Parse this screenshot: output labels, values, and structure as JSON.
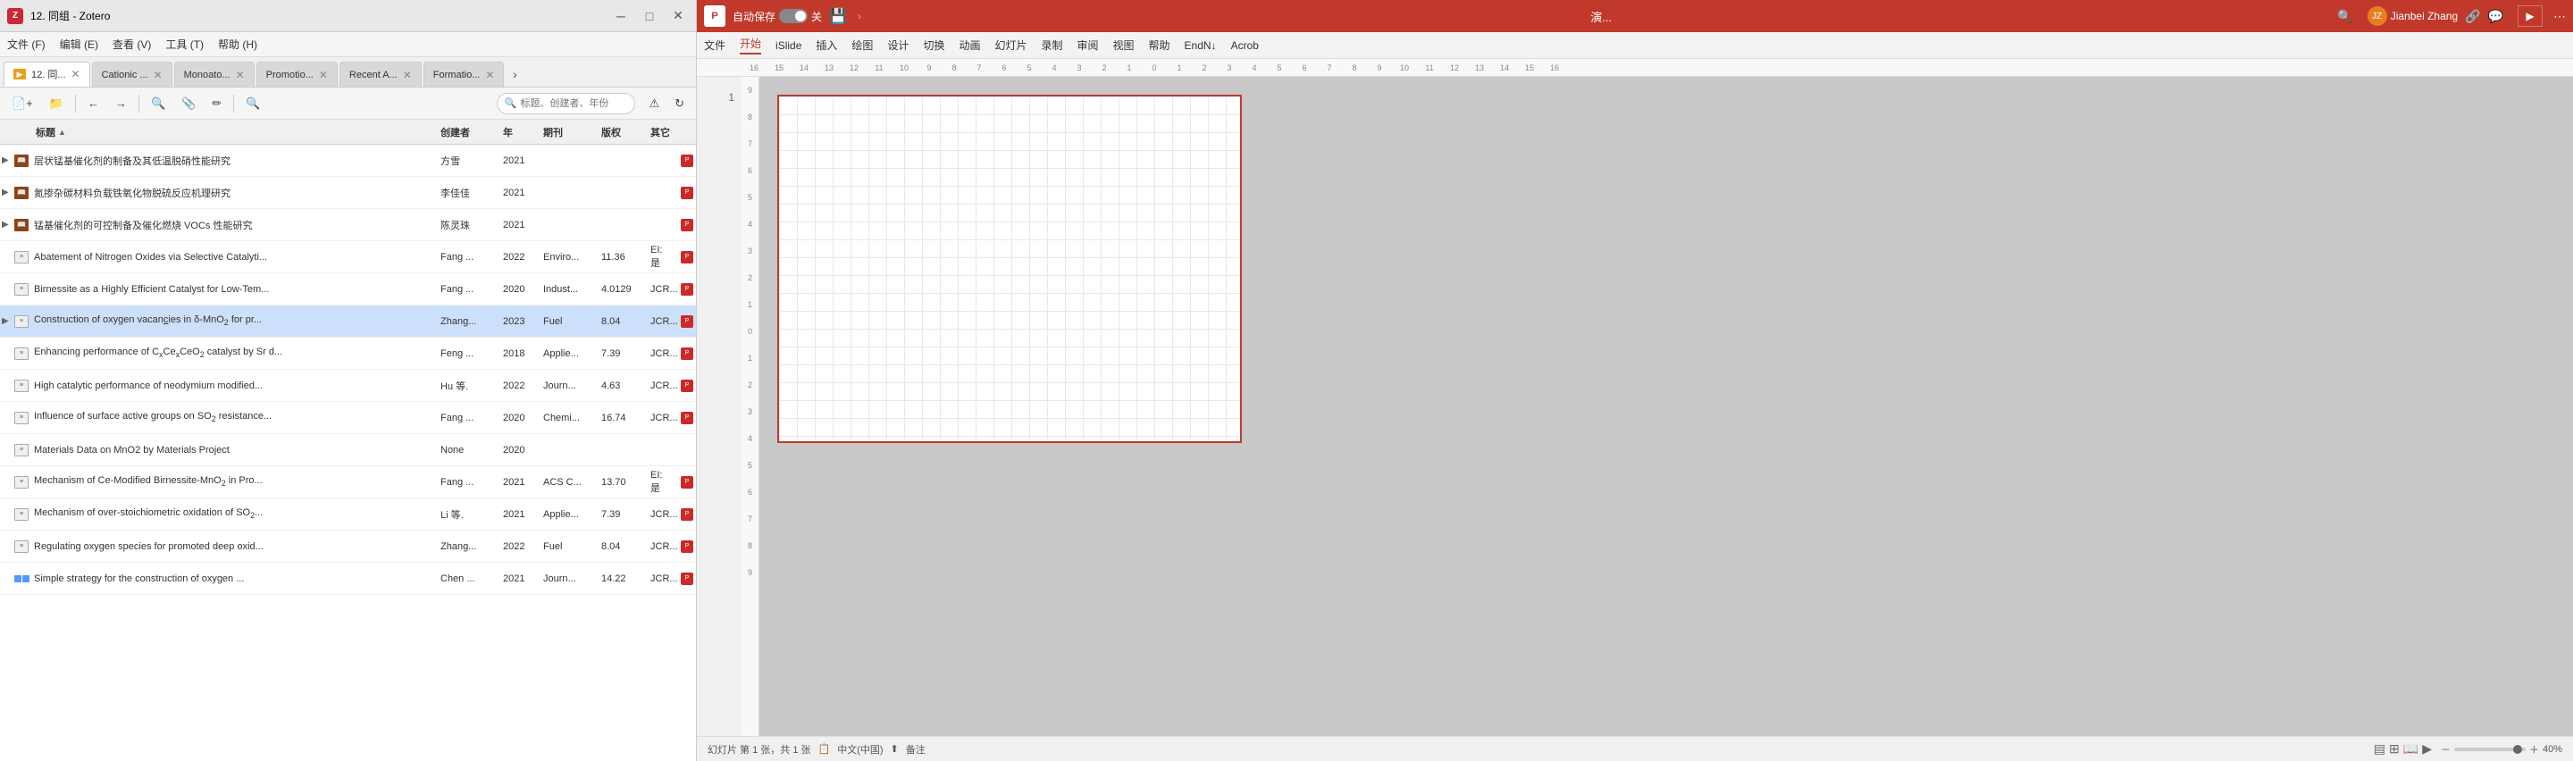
{
  "zotero": {
    "title": "12. 同组 - Zotero",
    "folder_name": "12. 同...",
    "menu": [
      "文件 (F)",
      "编辑 (E)",
      "查看 (V)",
      "工具 (T)",
      "帮助 (H)"
    ],
    "tabs": [
      {
        "label": "12. 同...",
        "active": true,
        "type": "folder"
      },
      {
        "label": "Cationic ...",
        "active": false
      },
      {
        "label": "Monoato...",
        "active": false
      },
      {
        "label": "Promotio...",
        "active": false
      },
      {
        "label": "Recent A...",
        "active": false
      },
      {
        "label": "Formatio...",
        "active": false
      }
    ],
    "search_placeholder": "标题、创建者、年份",
    "columns": {
      "title": "标题",
      "author": "创建者",
      "year": "年",
      "journal": "期刊",
      "rights": "版权",
      "other": "其它"
    },
    "rows": [
      {
        "id": 1,
        "type": "thesis",
        "title": "层状锰基催化剂的制备及其低温脱硝性能研究",
        "author": "方雪",
        "year": "2021",
        "journal": "",
        "rights": "",
        "other": "",
        "has_pdf": true,
        "selected": false
      },
      {
        "id": 2,
        "type": "thesis",
        "title": "氮掺杂碳材料负载铁氧化物脱硫反应机理研究",
        "author": "李佳佳",
        "year": "2021",
        "journal": "",
        "rights": "",
        "other": "",
        "has_pdf": true,
        "selected": false
      },
      {
        "id": 3,
        "type": "thesis",
        "title": "锰基催化剂的可控制备及催化燃烧 VOCs 性能研究",
        "author": "陈灵珠",
        "year": "2021",
        "journal": "",
        "rights": "",
        "other": "",
        "has_pdf": true,
        "selected": false
      },
      {
        "id": 4,
        "type": "article",
        "title": "Abatement of Nitrogen Oxides via Selective Catalyti...",
        "author": "Fang ...",
        "year": "2022",
        "journal": "Enviro...",
        "rights": "11.36",
        "other": "EI: 是",
        "has_pdf": true,
        "selected": false
      },
      {
        "id": 5,
        "type": "article",
        "title": "Birnessite as a Highly Efficient Catalyst for Low-Tem...",
        "author": "Fang ...",
        "year": "2020",
        "journal": "Indust...",
        "rights": "4.0129",
        "other": "JCR...",
        "has_pdf": true,
        "selected": false
      },
      {
        "id": 6,
        "type": "article",
        "title": "Construction of oxygen vacancies in δ-MnO₂ for pr...",
        "author": "Zhang...",
        "year": "2023",
        "journal": "Fuel",
        "rights": "8.04",
        "other": "JCR...",
        "has_pdf": true,
        "selected": true
      },
      {
        "id": 7,
        "type": "article",
        "title": "Enhancing performance of CₓₓCeO₂ catalyst by Sr d...",
        "author": "Feng ...",
        "year": "2018",
        "journal": "Applie...",
        "rights": "7.39",
        "other": "JCR...",
        "has_pdf": true,
        "selected": false
      },
      {
        "id": 8,
        "type": "article",
        "title": "High catalytic performance of neodymium modified...",
        "author": "Hu 等.",
        "year": "2022",
        "journal": "Journ...",
        "rights": "4.63",
        "other": "JCR...",
        "has_pdf": true,
        "selected": false
      },
      {
        "id": 9,
        "type": "article",
        "title": "Influence of surface active groups on SO₂ resistance...",
        "author": "Fang ...",
        "year": "2020",
        "journal": "Chemi...",
        "rights": "16.74",
        "other": "JCR...",
        "has_pdf": true,
        "selected": false
      },
      {
        "id": 10,
        "type": "article_plain",
        "title": "Materials Data on MnO2 by Materials Project",
        "author": "None",
        "year": "2020",
        "journal": "",
        "rights": "",
        "other": "",
        "has_pdf": false,
        "selected": false
      },
      {
        "id": 11,
        "type": "article",
        "title": "Mechanism of Ce-Modified Birnessite-MnO₂ in Pro...",
        "author": "Fang ...",
        "year": "2021",
        "journal": "ACS C...",
        "rights": "13.70",
        "other": "EI: 是",
        "has_pdf": true,
        "selected": false
      },
      {
        "id": 12,
        "type": "article",
        "title": "Mechanism of over-stoichiometric oxidation of SO₂...",
        "author": "Li 等.",
        "year": "2021",
        "journal": "Applie...",
        "rights": "7.39",
        "other": "JCR...",
        "has_pdf": true,
        "selected": false
      },
      {
        "id": 13,
        "type": "article",
        "title": "Regulating oxygen species for promoted deep oxid...",
        "author": "Zhang...",
        "year": "2022",
        "journal": "Fuel",
        "rights": "8.04",
        "other": "JCR...",
        "has_pdf": true,
        "selected": false
      },
      {
        "id": 14,
        "type": "article_color",
        "title": "Simple strategy for the construction of oxygen ...",
        "author": "Chen ...",
        "year": "2021",
        "journal": "Journ...",
        "rights": "14.22",
        "other": "JCR...",
        "has_pdf": true,
        "selected": false
      }
    ]
  },
  "powerpoint": {
    "title": "演...",
    "autosave_label": "自动保存",
    "autosave_state": "关",
    "user": "Jianbei Zhang",
    "menu": [
      "文件",
      "开始",
      "iSlide",
      "插入",
      "绘图",
      "设计",
      "切换",
      "动画",
      "幻灯片",
      "录制",
      "审阅",
      "视图",
      "帮助",
      "EndN↓",
      "Acrob"
    ],
    "active_menu": "开始",
    "ruler_numbers": [
      "16",
      "15",
      "14",
      "13",
      "12",
      "11",
      "10",
      "9",
      "8",
      "7",
      "6",
      "5",
      "4",
      "3",
      "2",
      "1",
      "0",
      "1",
      "2",
      "3",
      "4",
      "5",
      "6",
      "7",
      "8",
      "9",
      "10",
      "11",
      "12",
      "13",
      "14",
      "15",
      "16"
    ],
    "side_ruler_numbers": [
      "9",
      "8",
      "7",
      "6",
      "5",
      "4",
      "3",
      "2",
      "1",
      "0",
      "1",
      "2",
      "3",
      "4",
      "5",
      "6",
      "7",
      "8",
      "9"
    ],
    "slide_number": "1",
    "status": {
      "slide_info": "幻灯片 第 1 张，共 1 张",
      "language": "中文(中国)",
      "notes": "备注",
      "zoom": "40%"
    }
  }
}
